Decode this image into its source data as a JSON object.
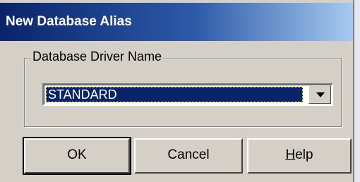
{
  "window": {
    "title": "New Database Alias"
  },
  "driver_group": {
    "legend": "Database Driver Name",
    "selected_value": "STANDARD"
  },
  "buttons": {
    "ok_label": "OK",
    "cancel_label": "Cancel",
    "help_label_accel": "H",
    "help_label_rest": "elp"
  },
  "colors": {
    "titlebar_start": "#0a246a",
    "titlebar_end": "#a6caf0",
    "dialog_face": "#d4d0c8",
    "selection": "#0a246a"
  },
  "icons": {
    "combo_arrow": "chevron-down-icon"
  }
}
